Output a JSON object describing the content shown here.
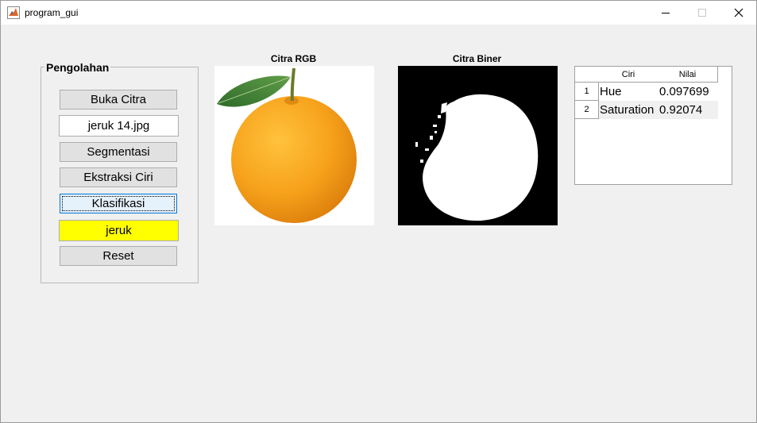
{
  "window": {
    "title": "program_gui",
    "minimize_icon": "minimize-icon",
    "maximize_icon": "maximize-icon",
    "close_icon": "close-icon"
  },
  "panel": {
    "title": "Pengolahan",
    "buttons": {
      "open": "Buka Citra",
      "segment": "Segmentasi",
      "extract": "Ekstraksi Ciri",
      "classify": "Klasifikasi",
      "reset": "Reset"
    },
    "filename": "jeruk 14.jpg",
    "result": "jeruk",
    "result_color": "#ffff00"
  },
  "axes": {
    "rgb_title": "Citra RGB",
    "binary_title": "Citra Biner"
  },
  "table": {
    "columns": [
      "Ciri",
      "Nilai"
    ],
    "rows": [
      {
        "index": "1",
        "ciri": "Hue",
        "nilai": "0.097699"
      },
      {
        "index": "2",
        "ciri": "Saturation",
        "nilai": "0.92074"
      }
    ]
  }
}
